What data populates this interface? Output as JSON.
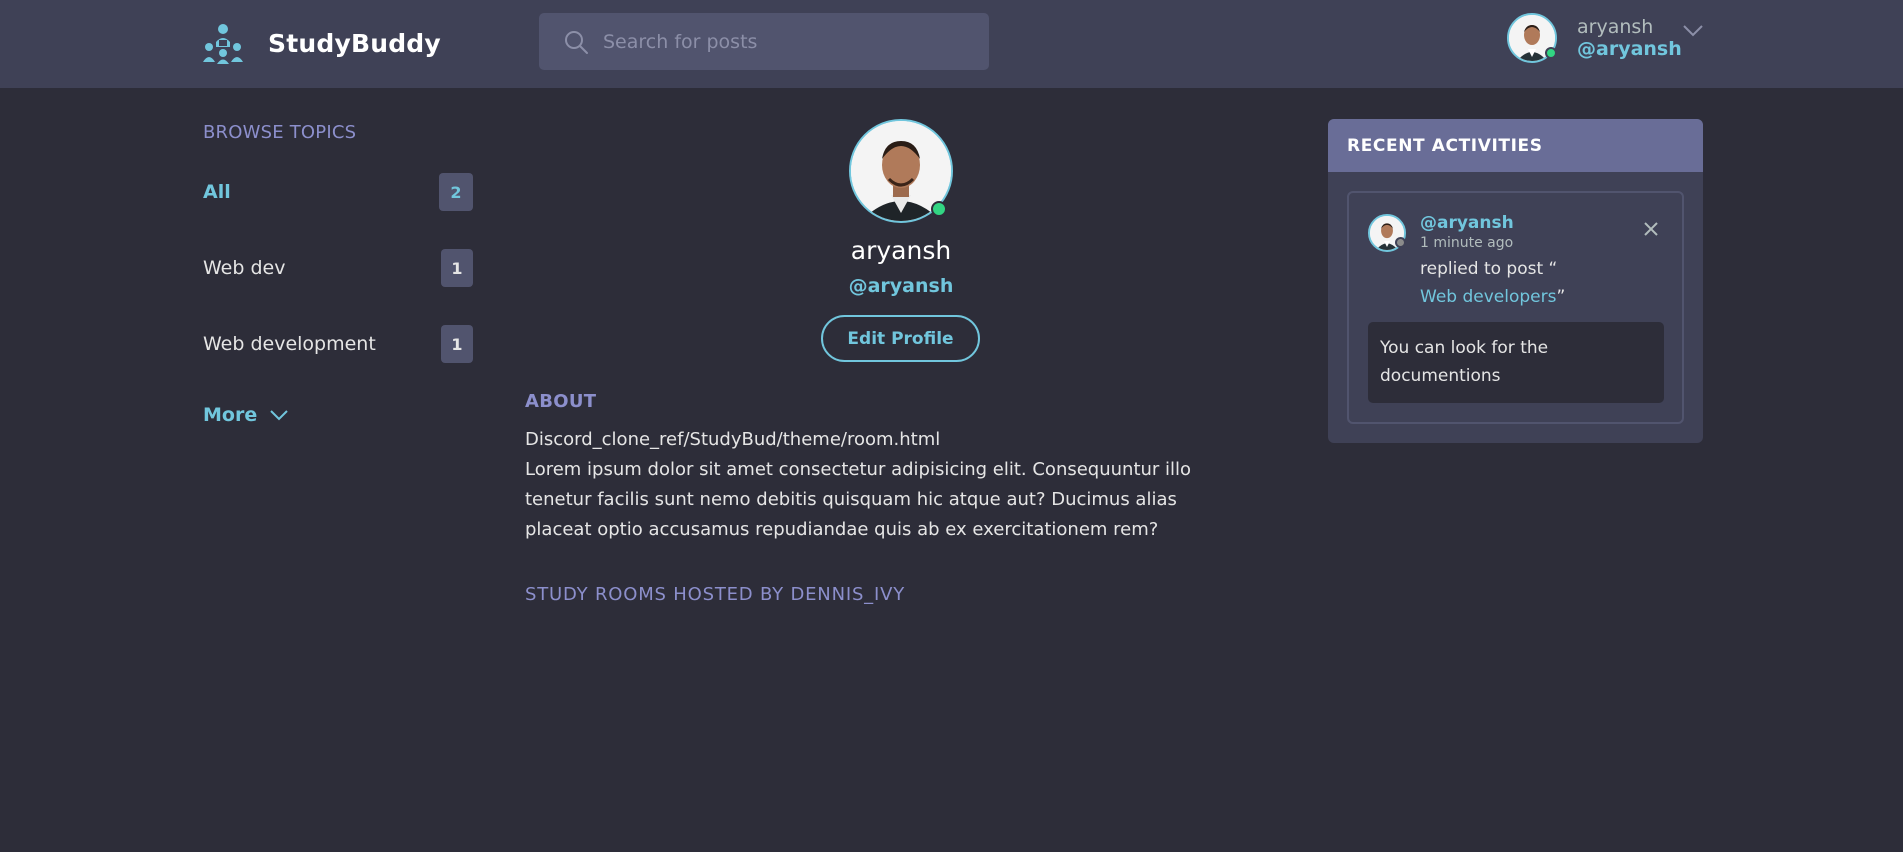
{
  "app": {
    "name": "StudyBuddy"
  },
  "search": {
    "placeholder": "Search for posts"
  },
  "user": {
    "name": "aryansh",
    "handle": "@aryansh"
  },
  "sidebar": {
    "title": "BROWSE TOPICS",
    "topics": [
      {
        "label": "All",
        "count": "2"
      },
      {
        "label": "Web dev",
        "count": "1"
      },
      {
        "label": "Web development",
        "count": "1"
      }
    ],
    "more_label": "More"
  },
  "profile": {
    "name": "aryansh",
    "handle": "@aryansh",
    "edit_label": "Edit Profile",
    "about_title": "ABOUT",
    "about_lines": [
      "Discord_clone_ref/StudyBud/theme/room.html",
      "Lorem ipsum dolor sit amet consectetur adipisicing elit. Consequuntur illo tenetur facilis sunt nemo debitis quisquam hic atque aut? Ducimus alias placeat optio accusamus repudiandae quis ab ex exercitationem rem?"
    ],
    "rooms_title": "STUDY ROOMS HOSTED BY DENNIS_IVY"
  },
  "activities": {
    "title": "RECENT ACTIVITIES",
    "items": [
      {
        "handle": "@aryansh",
        "time": "1 minute ago",
        "action_prefix": "replied to post “",
        "post_title": "Web developers",
        "action_suffix": "”",
        "message": "You can look for the documentions"
      }
    ]
  },
  "colors": {
    "accent": "#71c6dd",
    "header_bg": "#3f4156",
    "page_bg": "#2d2d39",
    "online": "#32d583"
  },
  "icons": [
    "logo-icon",
    "search-icon",
    "chevron-down-icon",
    "close-icon"
  ]
}
